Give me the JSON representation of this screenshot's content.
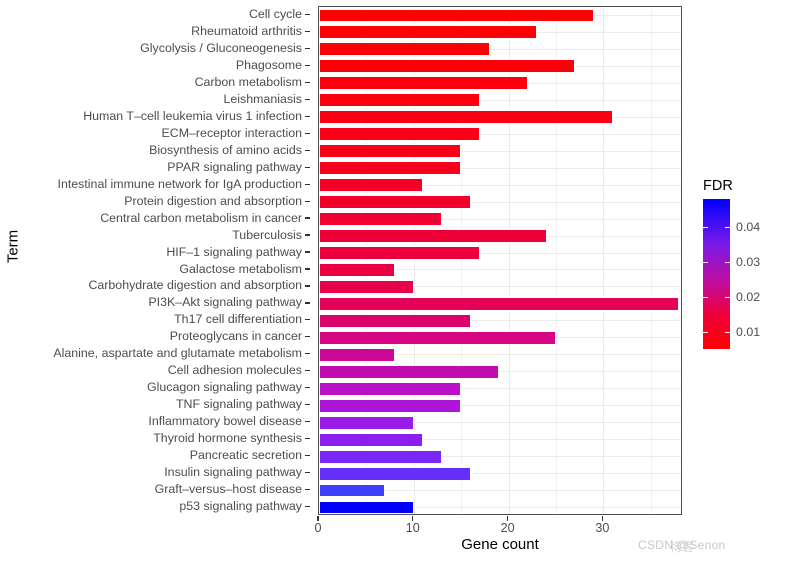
{
  "axes": {
    "y_title": "Term",
    "x_title": "Gene count",
    "x_ticks": [
      "0",
      "10",
      "20",
      "30"
    ],
    "x_tick_values": [
      0,
      10,
      20,
      30
    ],
    "x_range": [
      0,
      38.4
    ]
  },
  "legend": {
    "title": "FDR",
    "ticks": [
      "0.04",
      "0.03",
      "0.02",
      "0.01"
    ],
    "tick_values": [
      0.04,
      0.03,
      0.02,
      0.01
    ],
    "range": [
      0.005,
      0.048
    ],
    "low_color": "#ff0000",
    "high_color": "#0000ff"
  },
  "watermark": {
    "text": "CSDN @Senon",
    "cn_text": "博客"
  },
  "chart_data": {
    "type": "bar",
    "orientation": "horizontal",
    "title": "",
    "xlabel": "Gene count",
    "ylabel": "Term",
    "xlim": [
      0,
      38.4
    ],
    "grid": true,
    "legend_position": "right",
    "color_scale": {
      "name": "FDR",
      "low": "#ff0000",
      "high": "#0000ff",
      "domain": [
        0.005,
        0.048
      ]
    },
    "categories": [
      "Cell cycle",
      "Rheumatoid arthritis",
      "Glycolysis / Gluconeogenesis",
      "Phagosome",
      "Carbon metabolism",
      "Leishmaniasis",
      "Human T–cell leukemia virus 1 infection",
      "ECM–receptor interaction",
      "Biosynthesis of amino acids",
      "PPAR signaling pathway",
      "Intestinal immune network for IgA production",
      "Protein digestion and absorption",
      "Central carbon metabolism in cancer",
      "Tuberculosis",
      "HIF–1 signaling pathway",
      "Galactose metabolism",
      "Carbohydrate digestion and absorption",
      "PI3K–Akt signaling pathway",
      "Th17 cell differentiation",
      "Proteoglycans in cancer",
      "Alanine, aspartate and glutamate metabolism",
      "Cell adhesion molecules",
      "Glucagon signaling pathway",
      "TNF signaling pathway",
      "Inflammatory bowel disease",
      "Thyroid hormone synthesis",
      "Pancreatic secretion",
      "Insulin signaling pathway",
      "Graft–versus–host disease",
      "p53 signaling pathway"
    ],
    "values": [
      29,
      23,
      18,
      27,
      22,
      17,
      31,
      17,
      15,
      15,
      11,
      16,
      13,
      24,
      17,
      8,
      10,
      38,
      16,
      25,
      8,
      19,
      15,
      15,
      10,
      11,
      13,
      16,
      7,
      10
    ],
    "fdr": [
      0.005,
      0.0052,
      0.0055,
      0.0058,
      0.006,
      0.0062,
      0.0065,
      0.0068,
      0.0072,
      0.0075,
      0.008,
      0.0085,
      0.009,
      0.0095,
      0.01,
      0.0105,
      0.011,
      0.012,
      0.0135,
      0.015,
      0.0165,
      0.0185,
      0.0205,
      0.0225,
      0.0265,
      0.0295,
      0.033,
      0.0375,
      0.043,
      0.048
    ],
    "bar_colors": [
      "#ff0000",
      "#fe0003",
      "#fd0006",
      "#fc0009",
      "#fb000c",
      "#fa000f",
      "#f90012",
      "#f80015",
      "#f70019",
      "#f5001d",
      "#f30024",
      "#f1002a",
      "#ef0030",
      "#ed0037",
      "#eb003d",
      "#e90043",
      "#e7004a",
      "#e20059",
      "#dc026e",
      "#d50584",
      "#cd0898",
      "#c30cb0",
      "#b811c6",
      "#ac15d8",
      "#9a1ae8",
      "#8b1fef",
      "#7a26f5",
      "#6230fa",
      "#3d3ffd",
      "#0000ff"
    ]
  }
}
